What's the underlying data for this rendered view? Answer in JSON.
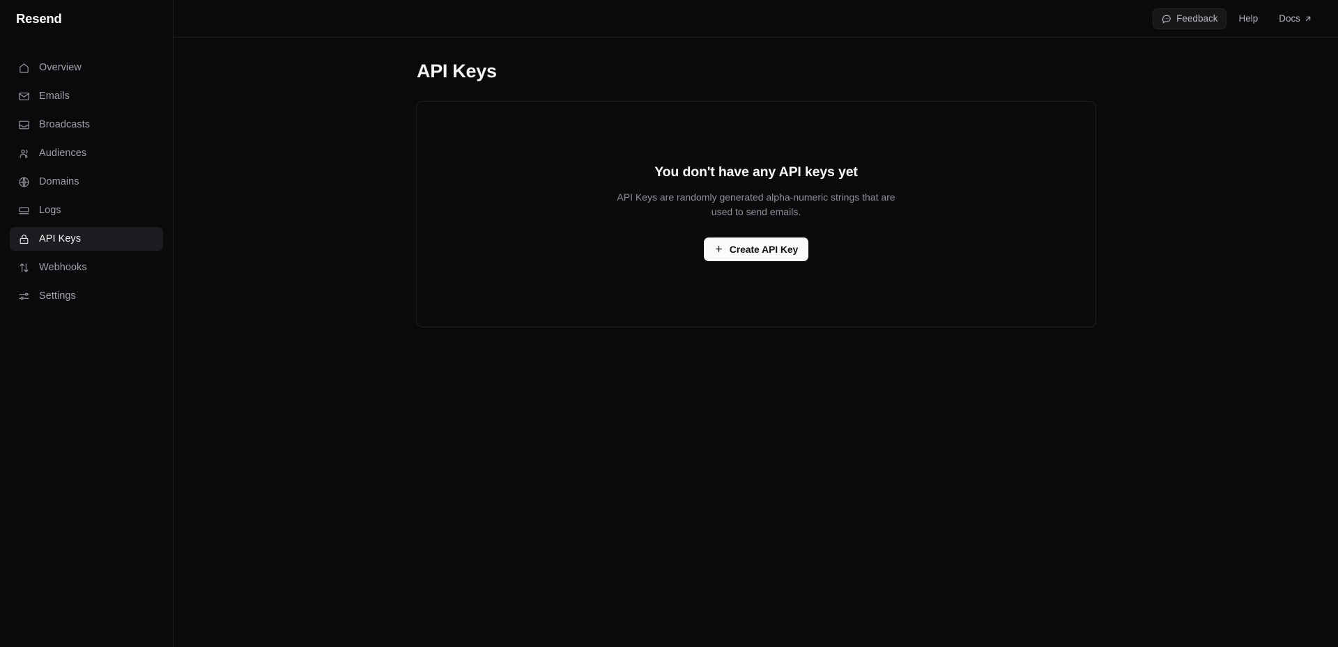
{
  "brand": {
    "name": "Resend"
  },
  "sidebar": {
    "items": [
      {
        "label": "Overview",
        "icon": "home-icon",
        "active": false
      },
      {
        "label": "Emails",
        "icon": "envelope-icon",
        "active": false
      },
      {
        "label": "Broadcasts",
        "icon": "inbox-icon",
        "active": false
      },
      {
        "label": "Audiences",
        "icon": "users-icon",
        "active": false
      },
      {
        "label": "Domains",
        "icon": "globe-icon",
        "active": false
      },
      {
        "label": "Logs",
        "icon": "logs-icon",
        "active": false
      },
      {
        "label": "API Keys",
        "icon": "lock-icon",
        "active": true
      },
      {
        "label": "Webhooks",
        "icon": "arrows-updown-icon",
        "active": false
      },
      {
        "label": "Settings",
        "icon": "sliders-icon",
        "active": false
      }
    ]
  },
  "topbar": {
    "feedback_label": "Feedback",
    "feedback_icon": "message-bubble-icon",
    "help_label": "Help",
    "docs_label": "Docs",
    "docs_icon": "external-link-arrow-icon"
  },
  "page": {
    "title": "API Keys"
  },
  "empty_state": {
    "title": "You don't have any API keys yet",
    "description": "API Keys are randomly generated alpha-numeric strings that are used to send emails.",
    "button_label": "Create API Key",
    "button_icon": "plus-icon"
  },
  "colors": {
    "background": "#0a0a0c",
    "border": "#1f2023",
    "active_item_bg": "#1b1c1f",
    "text_primary": "#f5f5f6",
    "text_muted": "#8e8f95",
    "button_bg": "#fbfbfb"
  }
}
